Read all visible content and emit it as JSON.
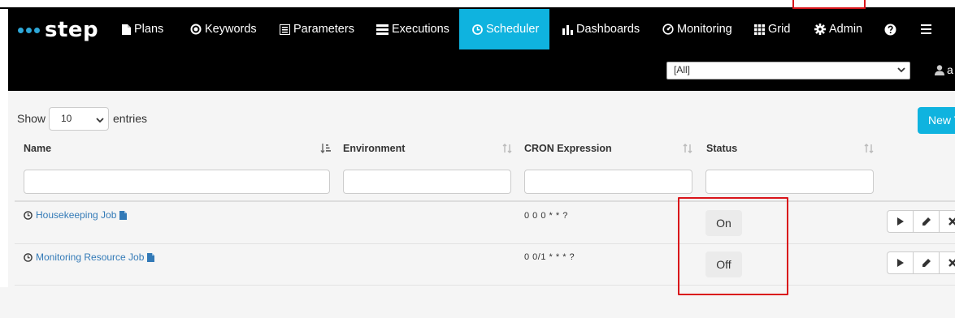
{
  "app": {
    "brand": "step"
  },
  "nav": {
    "items": [
      {
        "label": "Plans",
        "icon": "file-icon"
      },
      {
        "label": "Keywords",
        "icon": "dot-circle-icon"
      },
      {
        "label": "Parameters",
        "icon": "list-box-icon"
      },
      {
        "label": "Executions",
        "icon": "tasks-icon"
      },
      {
        "label": "Scheduler",
        "icon": "clock-icon",
        "active": true
      },
      {
        "label": "Dashboards",
        "icon": "bar-chart-icon"
      },
      {
        "label": "Monitoring",
        "icon": "dashboard-icon"
      },
      {
        "label": "Grid",
        "icon": "grid-icon"
      },
      {
        "label": "Admin",
        "icon": "gear-icon"
      }
    ],
    "tenant_selected": "[All]",
    "user_label": "a"
  },
  "table_controls": {
    "show_label": "Show",
    "entries_selected": "10",
    "entries_label": "entries",
    "new_button": "New Task"
  },
  "table": {
    "columns": [
      "Name",
      "Environment",
      "CRON Expression",
      "Status"
    ],
    "rows": [
      {
        "name": "Housekeeping Job",
        "environment": "",
        "cron": "0 0 0 * * ?",
        "status": "On"
      },
      {
        "name": "Monitoring Resource Job",
        "environment": "",
        "cron": "0 0/1 * * * ?",
        "status": "Off"
      }
    ]
  },
  "colors": {
    "accent": "#0fb3df",
    "navbar": "#000000",
    "link": "#337ab7",
    "highlight": "#d9151b"
  }
}
